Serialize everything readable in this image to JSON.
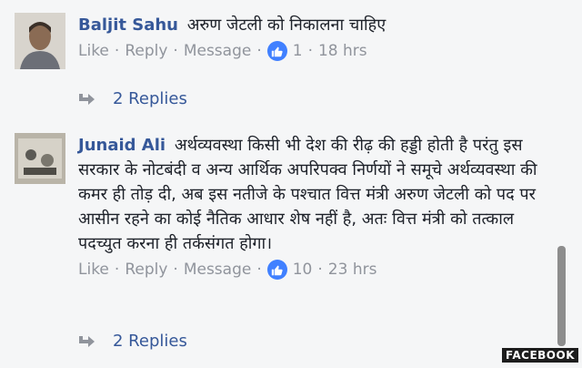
{
  "comments": [
    {
      "author": "Baljit Sahu",
      "text": "अरुण जेटली को निकालना चाहिए",
      "actions": {
        "like": "Like",
        "reply": "Reply",
        "message": "Message",
        "like_count": "1",
        "time": "18 hrs",
        "sep": "·"
      },
      "replies": "2 Replies"
    },
    {
      "author": "Junaid Ali",
      "text": "अर्थव्यवस्था किसी भी देश की रीढ़ की हड्डी होती है परंतु इस सरकार के नोटबंदी व अन्य आर्थिक अपरिपक्व निर्णयों ने समूचे अर्थव्यवस्था की कमर ही तोड़ दी, अब इस नतीजे के पश्चात वित्त मंत्री अरुण जेटली को पद पर आसीन रहने का कोई नैतिक आधार शेष नहीं है, अतः वित्त मंत्री को तत्काल पदच्युत करना ही तर्कसंगत होगा।",
      "actions": {
        "like": "Like",
        "reply": "Reply",
        "message": "Message",
        "like_count": "10",
        "time": "23 hrs",
        "sep": "·"
      },
      "replies": "2 Replies"
    }
  ],
  "watermark": "FACEBOOK",
  "colors": {
    "author": "#365899",
    "meta": "#90949c",
    "like_badge": "#4080ff"
  }
}
